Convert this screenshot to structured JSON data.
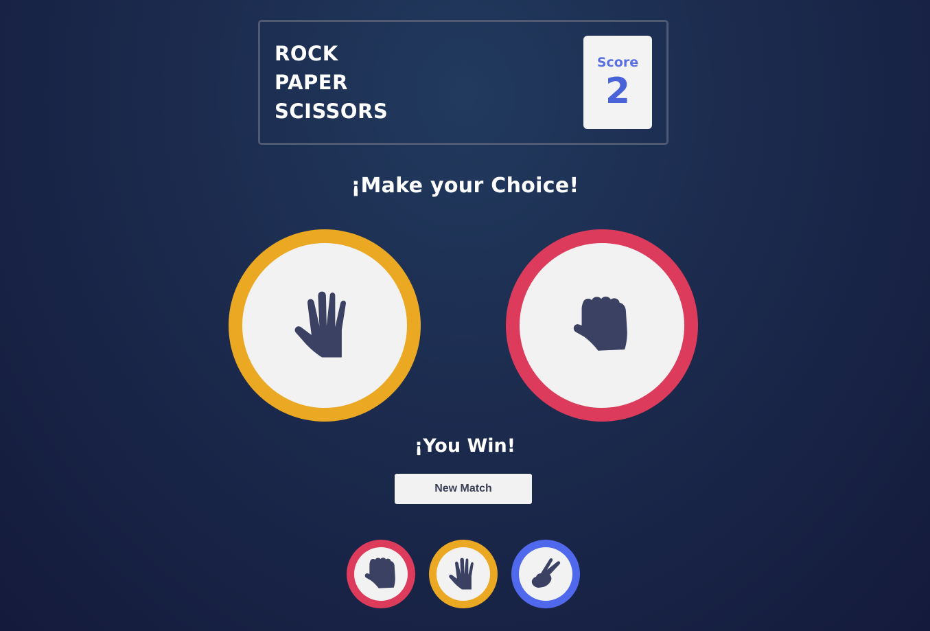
{
  "header": {
    "title_lines": [
      "ROCK",
      "PAPER",
      "SCISSORS"
    ],
    "score_label": "Score",
    "score_value": "2"
  },
  "prompt": "¡Make your Choice!",
  "match": {
    "player_choice": {
      "name": "paper",
      "icon": "paper-hand-icon",
      "color": "#eaa823"
    },
    "house_choice": {
      "name": "rock",
      "icon": "rock-fist-icon",
      "color": "#dd3b5b"
    },
    "result": "¡You Win!",
    "new_match_label": "New Match"
  },
  "choices": [
    {
      "name": "rock",
      "icon": "rock-fist-icon",
      "color": "#dd3b5b"
    },
    {
      "name": "paper",
      "icon": "paper-hand-icon",
      "color": "#eaa823"
    },
    {
      "name": "scissors",
      "icon": "scissors-hand-icon",
      "color": "#5068ec"
    }
  ],
  "colors": {
    "icon": "#3b4163",
    "score_text": "#4862d8",
    "token_face": "#f2f2f2"
  }
}
